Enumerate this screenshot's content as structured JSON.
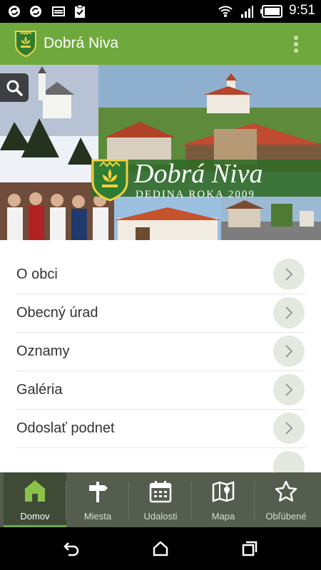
{
  "status_bar": {
    "time": "9:51",
    "icons": [
      "sync-icon",
      "sync-icon",
      "image-icon",
      "clipboard-check-icon",
      "wifi-icon",
      "signal-icon",
      "battery-icon"
    ]
  },
  "app_bar": {
    "title": "Dobrá Niva",
    "logo": "coat-of-arms-icon",
    "menu_icon": "more-vert-icon"
  },
  "hero": {
    "banner_title": "Dobrá Niva",
    "banner_subtitle": "DEDINA ROKA 2009",
    "search_icon": "search-icon"
  },
  "menu": {
    "items": [
      {
        "label": "O obci"
      },
      {
        "label": "Obecný úrad"
      },
      {
        "label": "Oznamy"
      },
      {
        "label": "Galéria"
      },
      {
        "label": "Odoslať podnet"
      }
    ]
  },
  "tabs": [
    {
      "label": "Domov",
      "icon": "home-icon",
      "active": true
    },
    {
      "label": "Miesta",
      "icon": "signpost-icon",
      "active": false
    },
    {
      "label": "Udalosti",
      "icon": "calendar-icon",
      "active": false
    },
    {
      "label": "Mapa",
      "icon": "map-icon",
      "active": false
    },
    {
      "label": "Obľúbené",
      "icon": "star-icon",
      "active": false
    }
  ],
  "nav_bar": {
    "buttons": [
      "back-icon",
      "home-nav-icon",
      "recents-icon"
    ]
  },
  "colors": {
    "accent": "#6fa93d",
    "tab_bar": "#555d4f",
    "tab_active": "#3f4a37"
  }
}
